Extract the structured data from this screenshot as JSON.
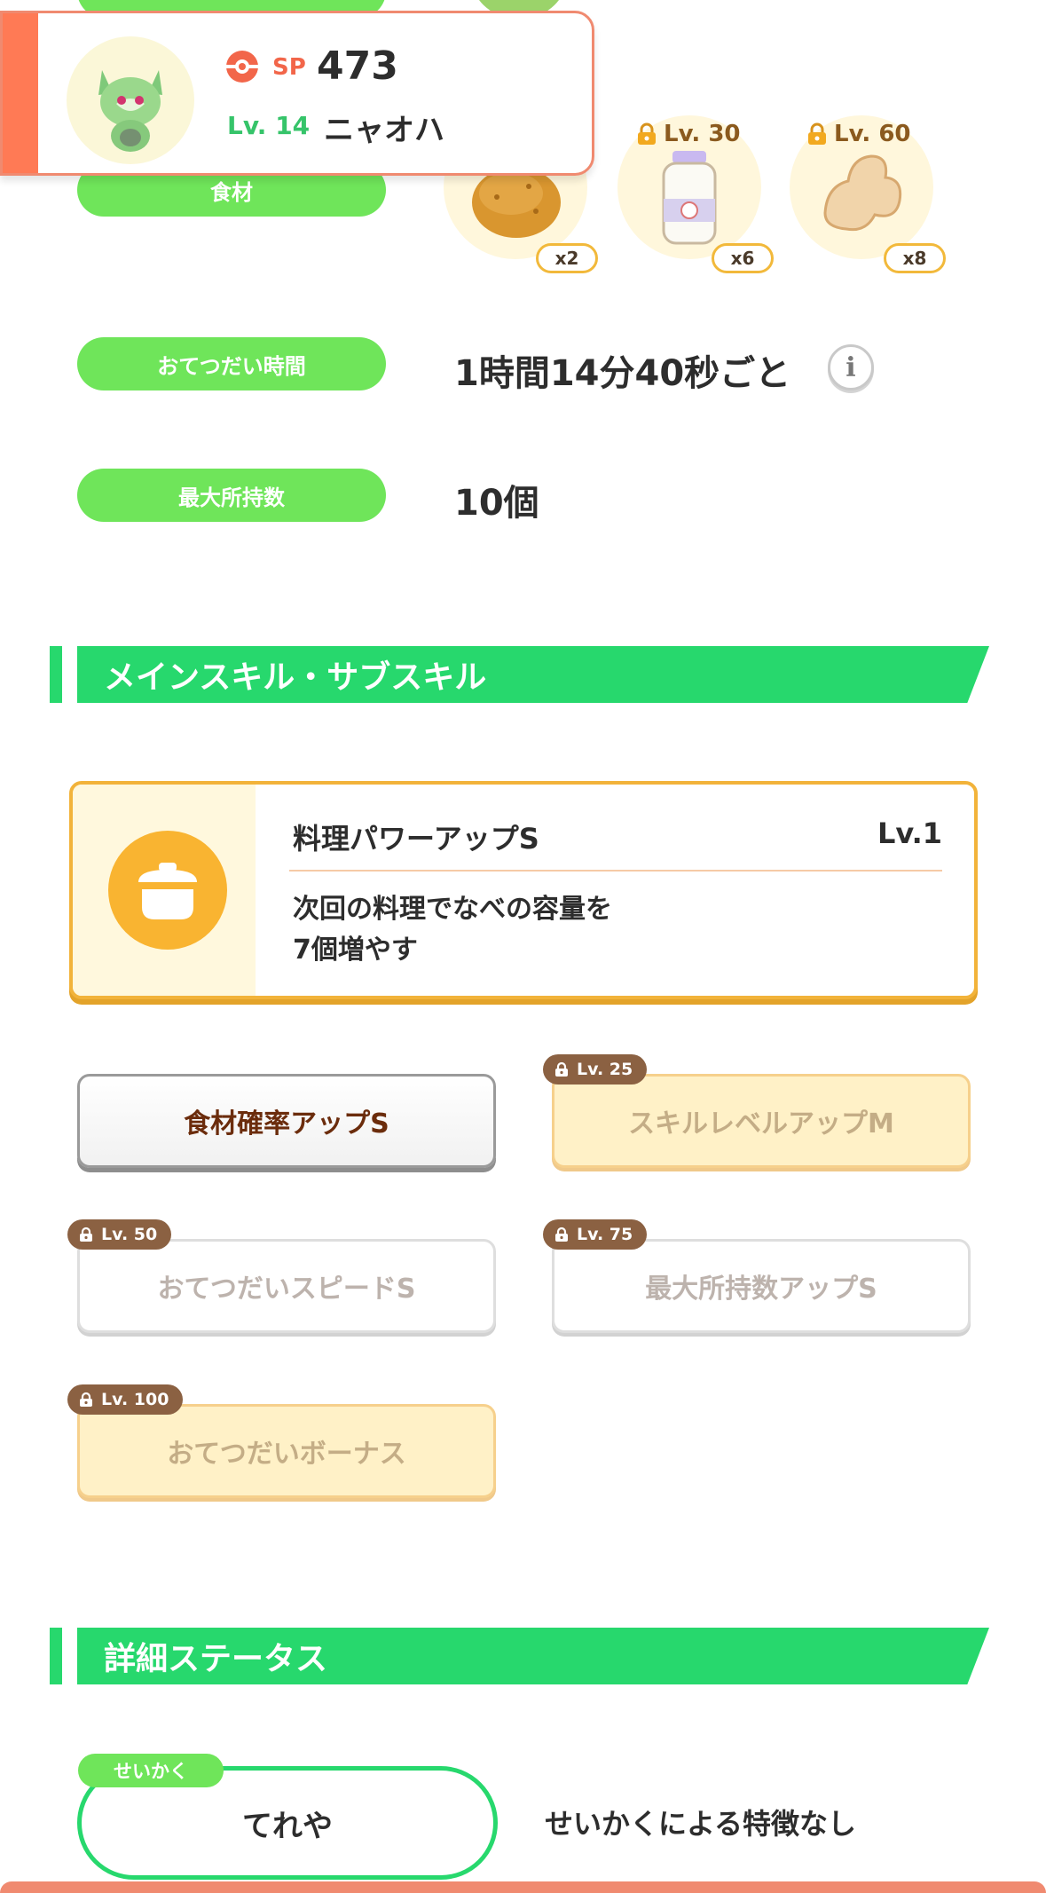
{
  "header": {
    "sp_label": "SP",
    "sp_value": "473",
    "level_label": "Lv. 14",
    "pokemon_name": "ニャオハ",
    "accent_color": "#ff7a55"
  },
  "ingredients": {
    "label": "食材",
    "items": [
      {
        "icon": "potato-icon",
        "qty": "x2",
        "unlock": ""
      },
      {
        "icon": "milk-bottle-icon",
        "qty": "x6",
        "unlock": "Lv. 30"
      },
      {
        "icon": "ginger-icon",
        "qty": "x8",
        "unlock": "Lv. 60"
      }
    ]
  },
  "help_time": {
    "label": "おてつだい時間",
    "value": "1時間14分40秒ごと",
    "info": "i"
  },
  "max_carry": {
    "label": "最大所持数",
    "value": "10個"
  },
  "skills_section": {
    "title": "メインスキル・サブスキル",
    "main_skill": {
      "name": "料理パワーアップS",
      "level": "Lv.1",
      "desc_line1": "次回の料理でなべの容量を",
      "desc_line2": "7個増やす"
    },
    "sub_skills": [
      {
        "name": "食材確率アップS",
        "unlock": ""
      },
      {
        "name": "スキルレベルアップM",
        "unlock": "Lv. 25"
      },
      {
        "name": "おてつだいスピードS",
        "unlock": "Lv. 50"
      },
      {
        "name": "最大所持数アップS",
        "unlock": "Lv. 75"
      },
      {
        "name": "おてつだいボーナス",
        "unlock": "Lv. 100"
      }
    ]
  },
  "details_section": {
    "title": "詳細ステータス",
    "nature_tag": "せいかく",
    "nature_name": "てれや",
    "nature_effect": "せいかくによる特徴なし"
  },
  "colors": {
    "green": "#27d86d",
    "pill_green": "#6fe55a",
    "gold": "#f2b33a",
    "tag_brown": "#8b6142"
  }
}
